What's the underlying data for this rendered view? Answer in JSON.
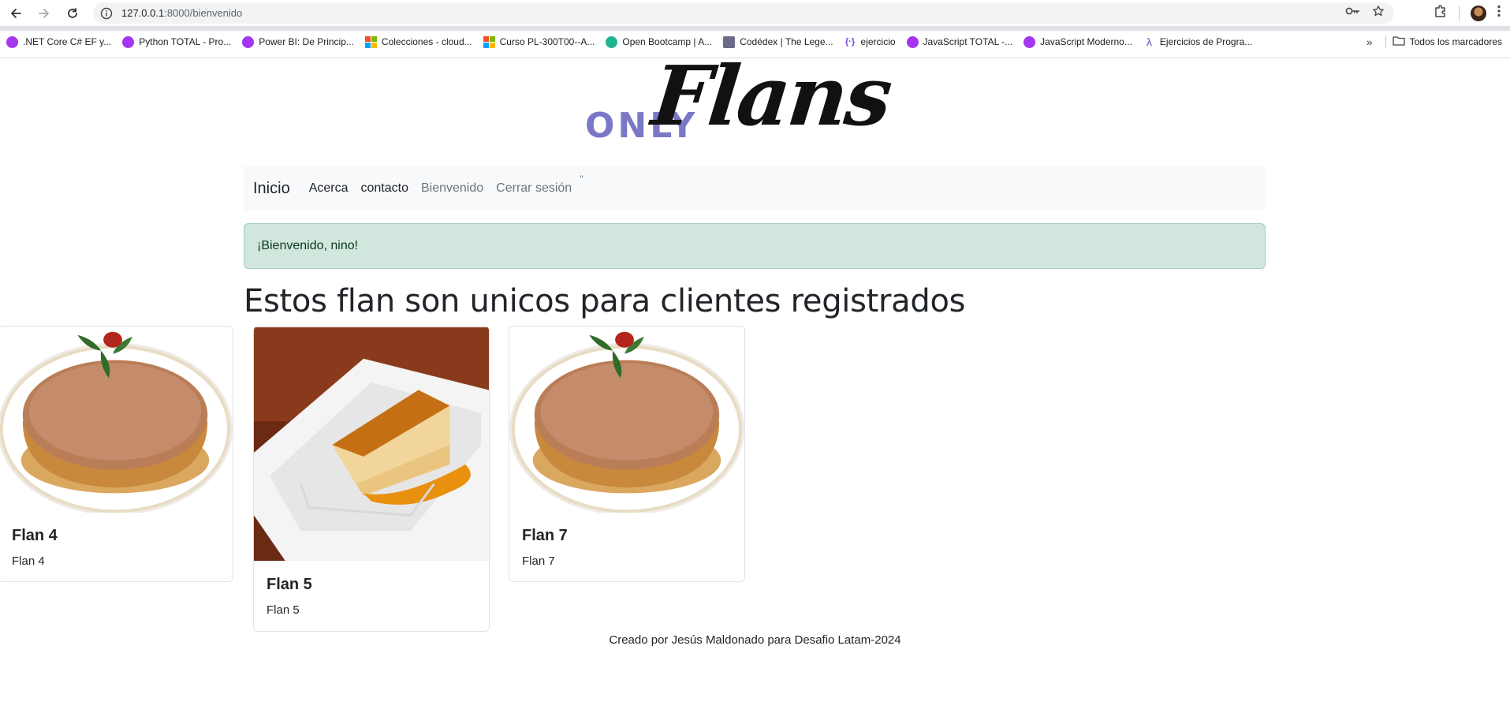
{
  "browser": {
    "url_host": "127.0.0.1",
    "url_rest": ":8000/bienvenido",
    "bookmarks": [
      {
        "label": ".NET Core C# EF y...",
        "icon": "udemy-icon"
      },
      {
        "label": "Python TOTAL - Pro...",
        "icon": "udemy-icon"
      },
      {
        "label": "Power BI: De Princip...",
        "icon": "udemy-icon"
      },
      {
        "label": "Colecciones - cloud...",
        "icon": "microsoft-icon"
      },
      {
        "label": "Curso PL-300T00--A...",
        "icon": "microsoft-icon"
      },
      {
        "label": "Open Bootcamp | A...",
        "icon": "openbootcamp-icon"
      },
      {
        "label": "Codédex | The Lege...",
        "icon": "codedex-icon"
      },
      {
        "label": "ejercicio",
        "icon": "brackets-icon"
      },
      {
        "label": "JavaScript TOTAL -...",
        "icon": "udemy-icon"
      },
      {
        "label": "JavaScript Moderno...",
        "icon": "udemy-icon"
      },
      {
        "label": "Ejercicios de Progra...",
        "icon": "lambda-icon"
      }
    ],
    "all_bookmarks": "Todos los marcadores"
  },
  "logo": {
    "only": "ONLY",
    "flans": "Flans"
  },
  "navbar": {
    "brand": "Inicio",
    "links": [
      "Acerca",
      "contacto",
      "Bienvenido",
      "Cerrar sesión"
    ],
    "quote": "\""
  },
  "alert": {
    "text": "¡Bienvenido, nino!"
  },
  "heading": "Estos flan son unicos para clientes registrados",
  "cards": [
    {
      "title": "Flan 4",
      "text": "Flan 4"
    },
    {
      "title": "Flan 5",
      "text": "Flan 5"
    },
    {
      "title": "Flan 7",
      "text": "Flan 7"
    }
  ],
  "footer": "Creado por Jesús Maldonado para Desafio Latam-2024",
  "colors": {
    "navbar_bg": "#f8f9fa",
    "alert_bg": "#d1e7dd",
    "logo_only": "#7a78c6"
  }
}
